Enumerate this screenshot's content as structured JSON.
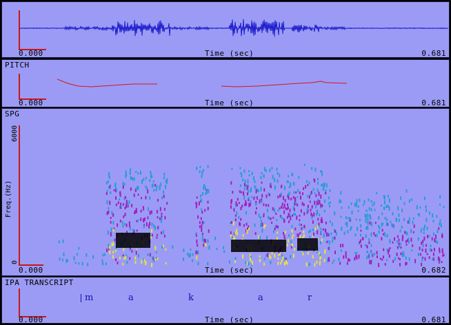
{
  "panels": {
    "waveform": {
      "time_start": "0.000",
      "time_axis_label": "Time (sec)",
      "time_end": "0.681",
      "trace_color": "#1a1acc"
    },
    "pitch": {
      "title": "PITCH",
      "time_start": "0.000",
      "time_axis_label": "Time (sec)",
      "time_end": "0.681",
      "trace_color": "#d01818"
    },
    "spectrogram": {
      "title": "SPG",
      "freq_axis_label": "Freq.(Hz)",
      "freq_max": "6000",
      "freq_min": "0",
      "time_start": "0.000",
      "time_axis_label": "Time (sec)",
      "time_end": "0.682"
    },
    "transcript": {
      "title": "IPA TRANSCRIPT",
      "phonemes": [
        "m",
        "a",
        "k",
        "a",
        "r"
      ],
      "time_start": "0.000",
      "time_axis_label": "Time (sec)",
      "time_end": "0.681"
    }
  },
  "colors": {
    "panel_bg": "#9b9bf5",
    "axis": "#c81616",
    "spg_low": "#2a9ad8",
    "spg_mid": "#a020c0",
    "spg_high": "#e8e040",
    "spg_peak": "#000000"
  }
}
